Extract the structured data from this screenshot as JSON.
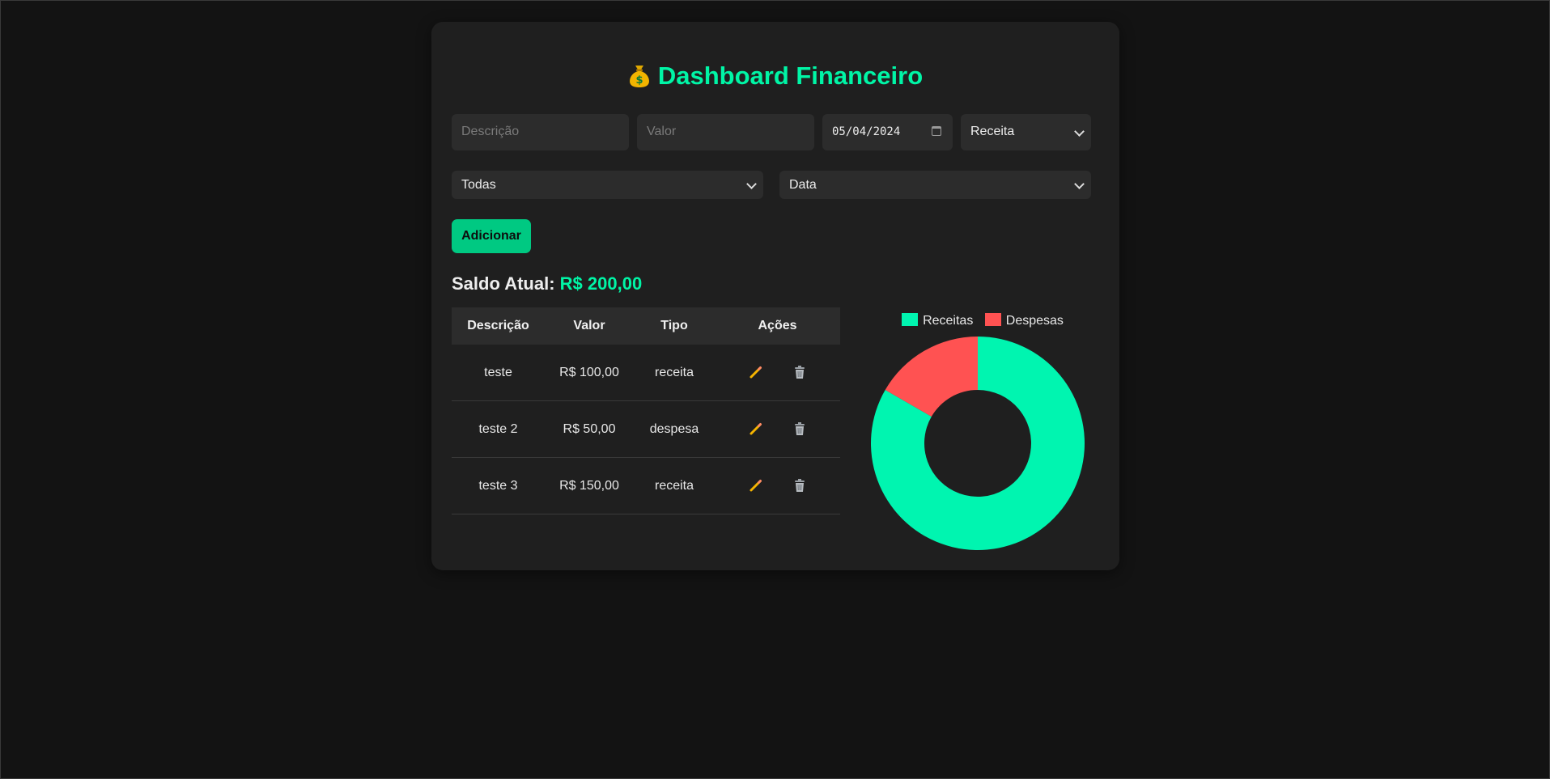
{
  "header": {
    "title": "Dashboard Financeiro",
    "icon": "money-bag-icon"
  },
  "form": {
    "description_placeholder": "Descrição",
    "value_placeholder": "Valor",
    "date_value": "05/04/2024",
    "type_selected": "Receita",
    "filter_selected": "Todas",
    "sort_selected": "Data",
    "add_label": "Adicionar"
  },
  "balance": {
    "label": "Saldo Atual:",
    "amount": "R$ 200,00"
  },
  "table": {
    "headers": [
      "Descrição",
      "Valor",
      "Tipo",
      "Ações"
    ],
    "rows": [
      {
        "description": "teste",
        "value": "R$ 100,00",
        "type": "receita"
      },
      {
        "description": "teste 2",
        "value": "R$ 50,00",
        "type": "despesa"
      },
      {
        "description": "teste 3",
        "value": "R$ 150,00",
        "type": "receita"
      }
    ]
  },
  "colors": {
    "accent": "#00f5a6",
    "button": "#00c982",
    "income": "#00f5b0",
    "expense": "#ff5252"
  },
  "chart_data": {
    "type": "pie",
    "categories": [
      "Receitas",
      "Despesas"
    ],
    "values": [
      250,
      50
    ],
    "colors": [
      "#00f5b0",
      "#ff5252"
    ],
    "legend": "top",
    "title": ""
  }
}
